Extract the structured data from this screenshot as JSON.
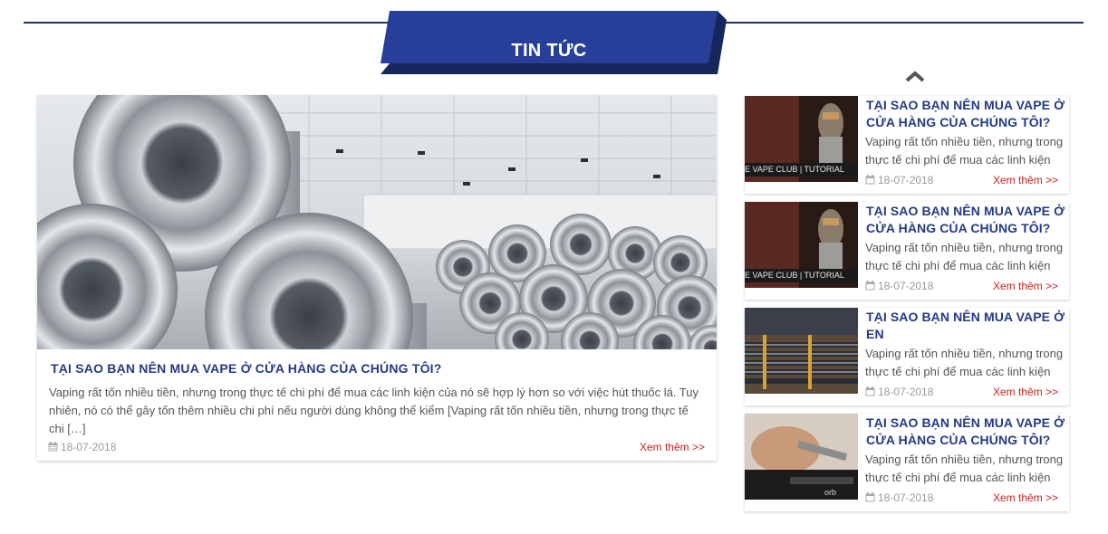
{
  "section": {
    "title": "TIN TỨC"
  },
  "featured": {
    "title": "TẠI SAO BẠN NÊN MUA VAPE Ở CỬA HÀNG CỦA CHÚNG TÔI?",
    "excerpt": "Vaping rất tốn nhiều tiền, nhưng trong thực tế chi phí để mua các linh kiện của nó sẽ hợp lý hơn so với việc hút thuốc lá. Tuy nhiên, nó có thể gây tốn thêm nhiều chi phí nếu người dùng không thể kiểm [Vaping rất tốn nhiều tiền, nhưng trong thực tế chi […]",
    "date": "18-07-2018",
    "more": "Xem thêm >>"
  },
  "side_items": [
    {
      "title": "TẠI SAO BẠN NÊN MUA VAPE Ở CỬA HÀNG CỦA CHÚNG TÔI?",
      "excerpt": "Vaping rất tốn nhiều tiền, nhưng trong thực tế chi phí để mua các linh kiện",
      "date": "18-07-2018",
      "more": "Xem thêm >>",
      "thumb_caption": "E VAPE CLUB | TUTORIAL"
    },
    {
      "title": "TẠI SAO BẠN NÊN MUA VAPE Ở CỬA HÀNG CỦA CHÚNG TÔI?",
      "excerpt": "Vaping rất tốn nhiều tiền, nhưng trong thực tế chi phí để mua các linh kiện",
      "date": "18-07-2018",
      "more": "Xem thêm >>",
      "thumb_caption": "E VAPE CLUB | TUTORIAL"
    },
    {
      "title": "TẠI SAO BẠN NÊN MUA VAPE Ở EN",
      "excerpt": "Vaping rất tốn nhiều tiền, nhưng trong thực tế chi phí để mua các linh kiện",
      "date": "18-07-2018",
      "more": "Xem thêm >>"
    },
    {
      "title": "TẠI SAO BẠN NÊN MUA VAPE Ở CỬA HÀNG CỦA CHÚNG TÔI?",
      "excerpt": "Vaping rất tốn nhiều tiền, nhưng trong thực tế chi phí để mua các linh kiện",
      "date": "18-07-2018",
      "more": "Xem thêm >>",
      "thumb_caption": "orb"
    }
  ],
  "icons": {
    "date": "calendar-icon",
    "scroll": "chevron-up-icon"
  },
  "colors": {
    "header_blue": "#263f97",
    "header_dark": "#16275e",
    "title_blue": "#233a86",
    "link_red": "#d11b1b"
  }
}
